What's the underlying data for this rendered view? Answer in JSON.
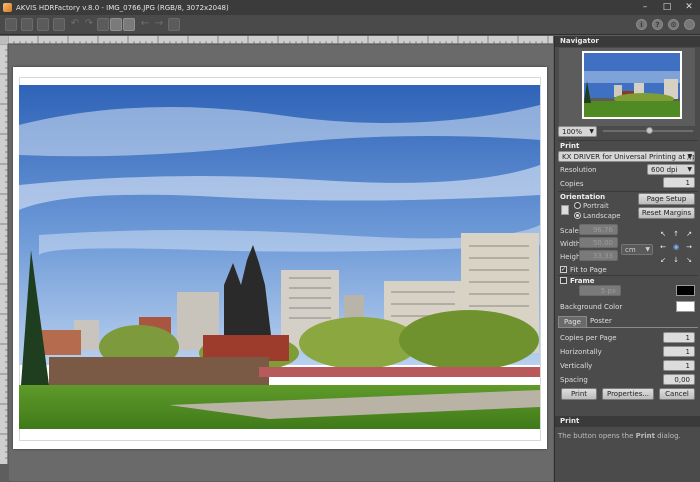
{
  "window": {
    "title": "AKVIS HDRFactory v.8.0 - IMG_0766.JPG (RGB/8, 3072x2048)",
    "controls": [
      "–",
      "□",
      "✕"
    ]
  },
  "toolbar": {
    "left_icons": [
      "open-icon",
      "save-icon",
      "print-icon",
      "batch-icon",
      "undo-icon",
      "redo-icon",
      "before-icon",
      "after-icon",
      "back-icon",
      "forward-icon",
      "preferences-icon"
    ],
    "right_icons": [
      "info-icon",
      "help-icon",
      "settings-icon",
      "user-icon"
    ],
    "right_glyphs": [
      "i",
      "?",
      "⚙",
      "👤"
    ]
  },
  "navigator": {
    "title": "Navigator",
    "zoom": "100%"
  },
  "print": {
    "section_label": "Print",
    "printer": "KX DRIVER for Universal Printing at //p...",
    "resolution_label": "Resolution",
    "resolution_value": "600 dpi",
    "copies_label": "Copies",
    "copies_value": "1",
    "orientation_label": "Orientation",
    "portrait_label": "Portrait",
    "landscape_label": "Landscape",
    "orientation_selected": "Landscape",
    "page_setup_label": "Page Setup",
    "reset_margins_label": "Reset Margins",
    "scale_label": "Scale",
    "scale_value": "96,76",
    "width_label": "Width",
    "width_value": "50,00",
    "height_label": "Height",
    "height_value": "33,33",
    "unit": "cm",
    "fit_to_page_label": "Fit to Page",
    "fit_to_page_checked": true,
    "frame_label": "Frame",
    "frame_checked": false,
    "frame_width_value": "5 px",
    "frame_color": "#000000",
    "background_color_label": "Background Color",
    "background_color": "#ffffff"
  },
  "tabs": [
    {
      "label": "Page",
      "active": true
    },
    {
      "label": "Poster",
      "active": false
    }
  ],
  "page_tab": {
    "copies_per_page_label": "Copies per Page",
    "copies_per_page_value": "1",
    "horizontally_label": "Horizontally",
    "horizontally_value": "1",
    "vertically_label": "Vertically",
    "vertically_value": "1",
    "spacing_label": "Spacing",
    "spacing_value": "0,00 cm"
  },
  "buttons": {
    "print": "Print",
    "properties": "Properties...",
    "cancel": "Cancel"
  },
  "hint": {
    "title": "Print",
    "text_before": "The button opens the ",
    "text_bold": "Print",
    "text_after": " dialog."
  }
}
